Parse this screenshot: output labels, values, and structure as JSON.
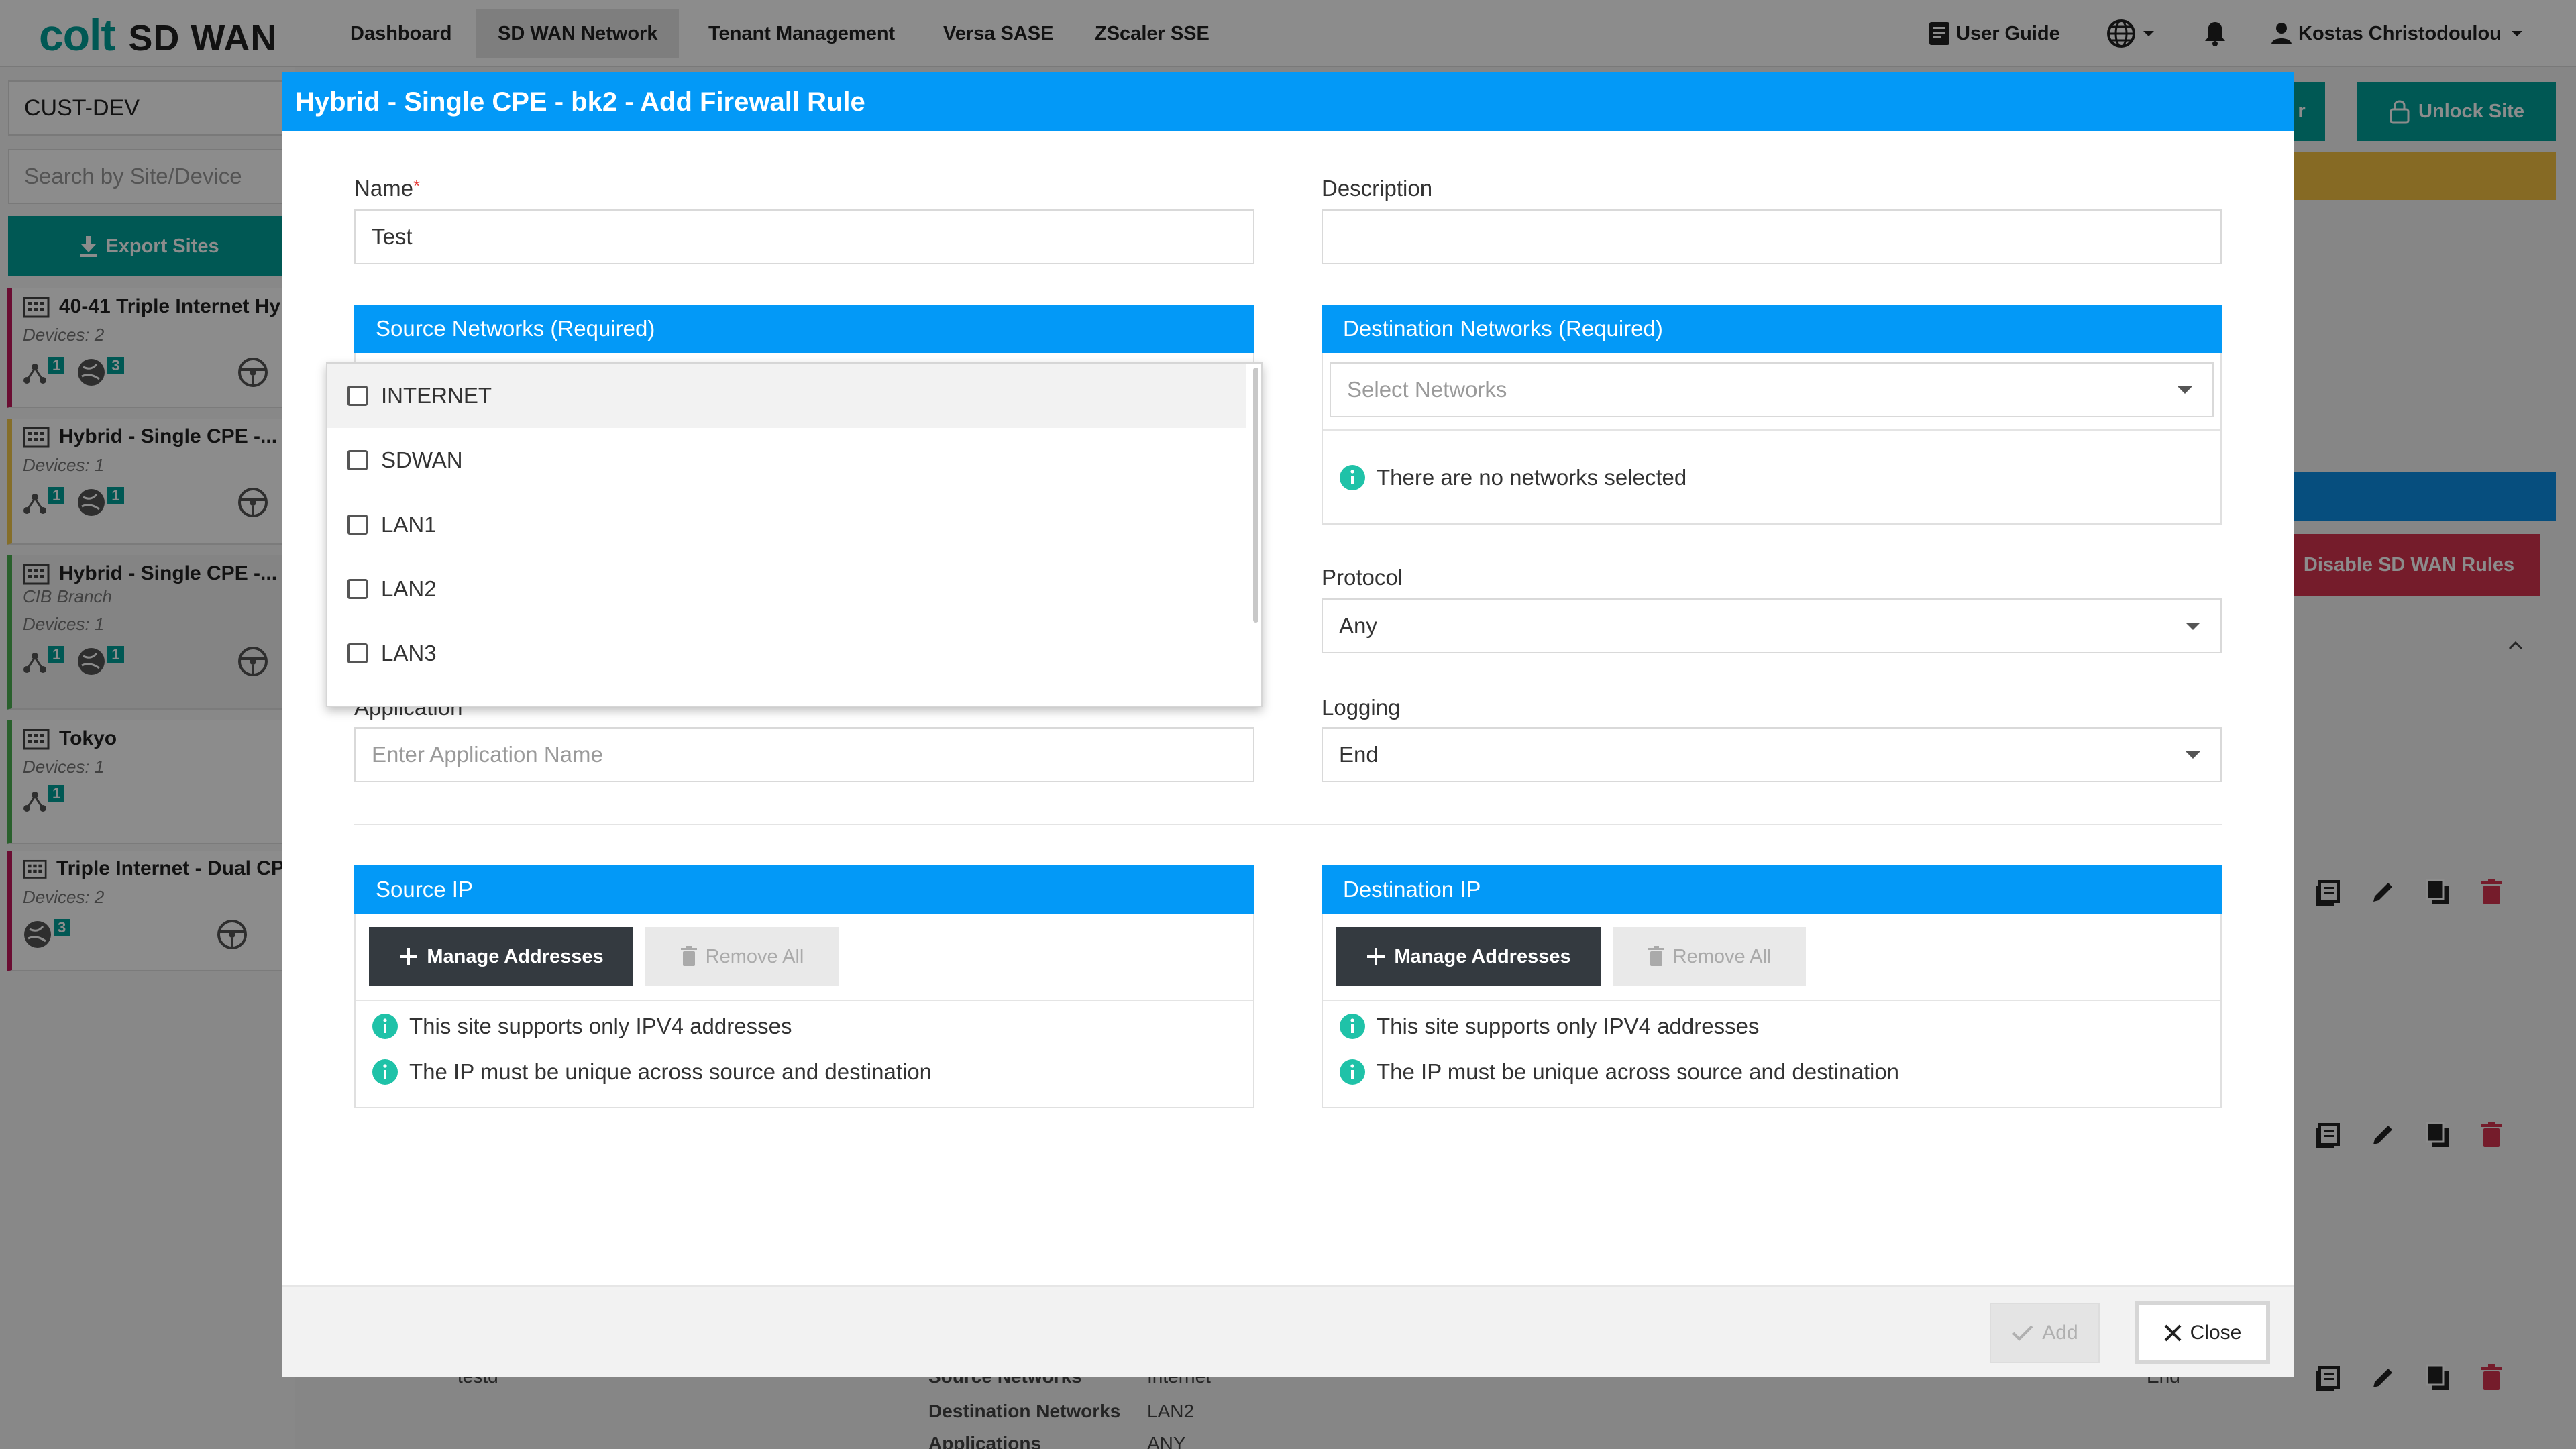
{
  "nav": {
    "logo_colt": "colt",
    "logo_sdwan": "SD WAN",
    "tabs": [
      "Dashboard",
      "SD WAN Network",
      "Tenant Management",
      "Versa SASE",
      "ZScaler SSE"
    ],
    "user_guide": "User Guide",
    "user_name": "Kostas Christodoulou"
  },
  "sidebar": {
    "customer": "CUST-DEV",
    "search_placeholder": "Search by Site/Device",
    "export_label": "Export Sites",
    "sites": [
      {
        "name": "40-41 Triple Internet Hy",
        "devices": "Devices: 2",
        "b1": "1",
        "b2": "3"
      },
      {
        "name": "Hybrid - Single CPE -...",
        "devices": "Devices: 1",
        "b1": "1",
        "b2": "1"
      },
      {
        "name": "Hybrid - Single CPE -...",
        "branch": "CIB Branch",
        "devices": "Devices: 1",
        "b1": "1",
        "b2": "1"
      },
      {
        "name": "Tokyo",
        "devices": "Devices: 1",
        "b1": "1"
      },
      {
        "name": "Triple Internet - Dual CP",
        "devices": "Devices: 2",
        "b1": "3"
      }
    ]
  },
  "background": {
    "unlock_site": "Unlock Site",
    "partial_btn": "r",
    "disable_rules": "Disable SD WAN Rules",
    "row_name": "testd",
    "source_networks_label": "Source Networks",
    "source_networks_value": "Internet",
    "dest_networks_label": "Destination Networks",
    "dest_networks_value": "LAN2",
    "applications_label": "Applications",
    "applications_value": "ANY",
    "end_value": "End"
  },
  "modal": {
    "title": "Hybrid - Single CPE - bk2 - Add Firewall Rule",
    "name_label": "Name",
    "name_required": "*",
    "name_value": "Test",
    "description_label": "Description",
    "description_value": "",
    "source_networks_title": "Source Networks (Required)",
    "source_options": [
      "INTERNET",
      "SDWAN",
      "LAN1",
      "LAN2",
      "LAN3"
    ],
    "destination_networks_title": "Destination Networks (Required)",
    "select_networks_placeholder": "Select Networks",
    "no_networks_msg": "There are no networks selected",
    "protocol_label": "Protocol",
    "protocol_value": "Any",
    "application_label": "Application",
    "application_placeholder": "Enter Application Name",
    "logging_label": "Logging",
    "logging_value": "End",
    "source_ip_title": "Source IP",
    "destination_ip_title": "Destination IP",
    "manage_addresses": "Manage Addresses",
    "remove_all": "Remove All",
    "ipv4_msg": "This site supports only IPV4 addresses",
    "unique_msg": "The IP must be unique across source and destination",
    "add_label": "Add",
    "close_label": "Close"
  },
  "colors": {
    "brand_teal": "#00a19a",
    "header_blue": "#0399f7",
    "info_green": "#1fc2a8",
    "danger": "#d6334f",
    "dark_button": "#343a40"
  }
}
